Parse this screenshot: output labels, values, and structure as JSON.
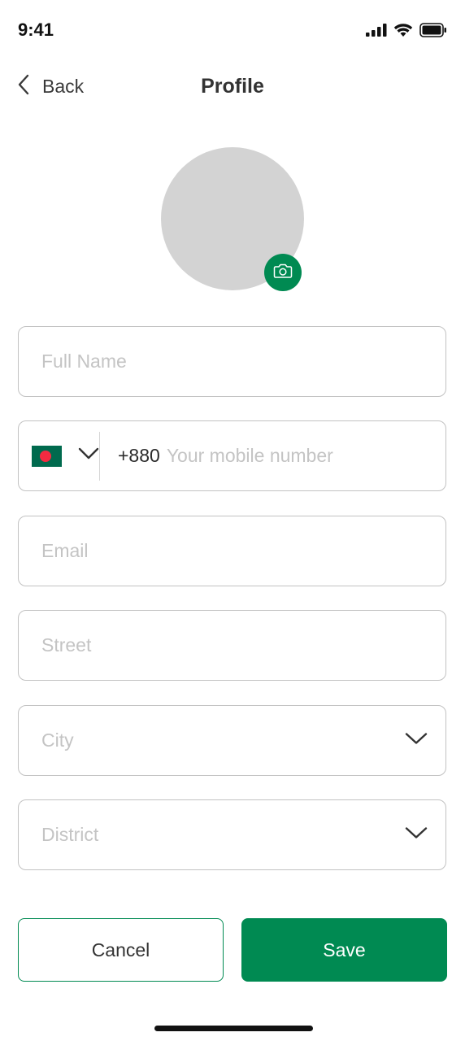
{
  "status_bar": {
    "time": "9:41",
    "icons": [
      "signal-icon",
      "wifi-icon",
      "battery-icon"
    ]
  },
  "header": {
    "back_label": "Back",
    "title": "Profile"
  },
  "avatar": {
    "camera_icon": "camera-icon"
  },
  "form": {
    "full_name": {
      "placeholder": "Full Name",
      "value": ""
    },
    "phone": {
      "country_flag": "bangladesh-flag",
      "dial_code": "+880",
      "placeholder": "Your mobile number",
      "value": ""
    },
    "email": {
      "placeholder": "Email",
      "value": ""
    },
    "street": {
      "placeholder": "Street",
      "value": ""
    },
    "city": {
      "placeholder": "City",
      "value": ""
    },
    "district": {
      "placeholder": "District",
      "value": ""
    }
  },
  "actions": {
    "cancel_label": "Cancel",
    "save_label": "Save"
  },
  "colors": {
    "accent": "#008a52",
    "placeholder": "#c4c4c4",
    "border": "#c2c2c2",
    "avatar_bg": "#d3d3d3"
  }
}
